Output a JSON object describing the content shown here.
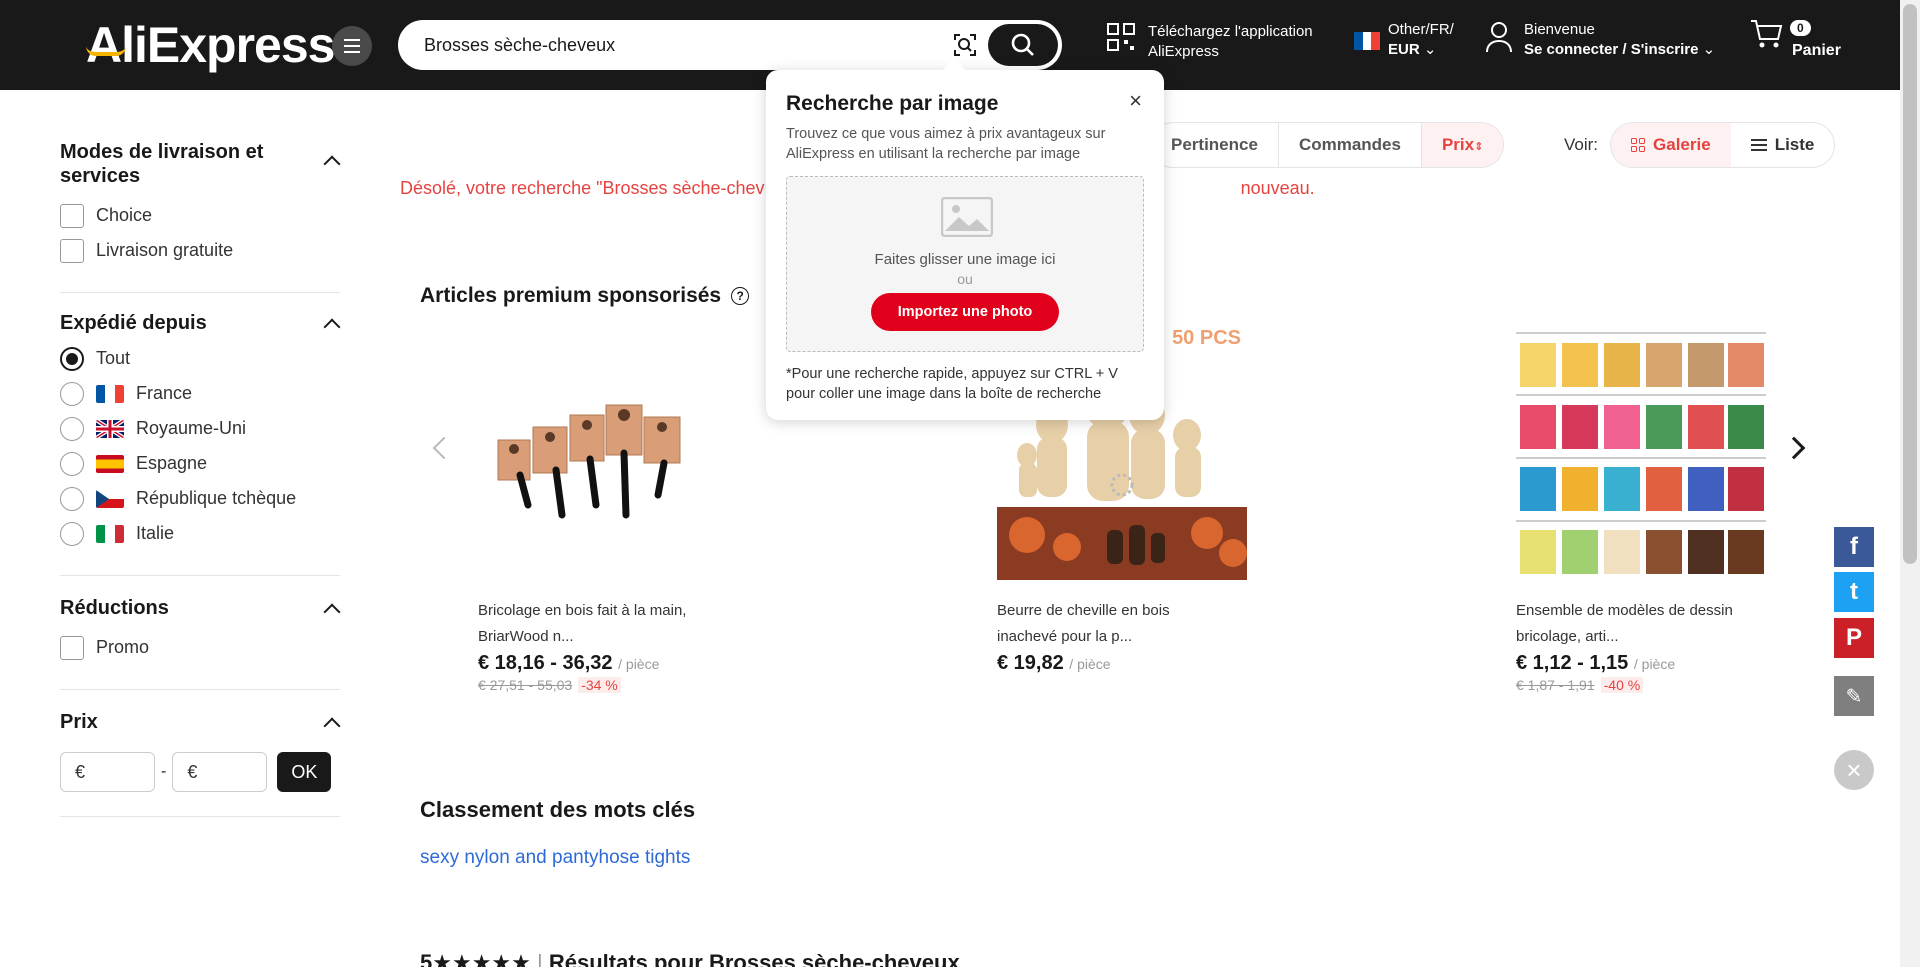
{
  "header": {
    "logo": "AliExpress",
    "search_value": "Brosses sèche-cheveux",
    "app_line1": "Téléchargez l'application",
    "app_line2": "AliExpress",
    "lang_line1": "Other/FR/",
    "lang_line2": "EUR",
    "user_line1": "Bienvenue",
    "user_line2": "Se connecter / S'inscrire",
    "cart_count": "0",
    "cart_label": "Panier"
  },
  "filters": {
    "delivery": {
      "title": "Modes de livraison et services",
      "items": [
        "Choice",
        "Livraison gratuite"
      ]
    },
    "ship_from": {
      "title": "Expédié depuis",
      "selected": "Tout",
      "items": [
        "Tout",
        "France",
        "Royaume-Uni",
        "Espagne",
        "République tchèque",
        "Italie"
      ]
    },
    "discounts": {
      "title": "Réductions",
      "items": [
        "Promo"
      ]
    },
    "price": {
      "title": "Prix",
      "min_placeholder": "€",
      "max_placeholder": "€",
      "separator": "-",
      "ok_label": "OK"
    }
  },
  "sort": {
    "options": [
      "Pertinence",
      "Commandes",
      "Prix"
    ],
    "active": "Prix",
    "view_label": "Voir:",
    "gallery_label": "Galerie",
    "list_label": "Liste"
  },
  "sorry_message": "Désolé, votre recherche \"Brosses sèche-chev",
  "sorry_message_end": "nouveau.",
  "sponsored": {
    "title": "Articles premium sponsorisés",
    "products": [
      {
        "title_line1": "Bricolage en bois fait à la main,",
        "title_line2": "BriarWood n...",
        "price": "€ 18,16 - 36,32",
        "unit": "/ pièce",
        "old_price": "€ 27,51 - 55,03",
        "discount": "-34 %"
      },
      {
        "title_line1": "Beurre de cheville en bois",
        "title_line2": "inachevé pour la p...",
        "price": "€ 19,82",
        "unit": "/ pièce",
        "old_price": "",
        "discount": "",
        "image_badge": "50 PCS"
      },
      {
        "title_line1": "Ensemble de modèles de dessin",
        "title_line2": "bricolage, arti...",
        "price": "€ 1,12 - 1,15",
        "unit": "/ pièce",
        "old_price": "€ 1,87 - 1,91",
        "discount": "-40 %"
      }
    ]
  },
  "keywords": {
    "title": "Classement des mots clés",
    "link": "sexy nylon and pantyhose tights"
  },
  "results_heading": {
    "prefix": "5",
    "text": "Résultats pour Brosses sèche-cheveux"
  },
  "popup": {
    "title": "Recherche par image",
    "close": "×",
    "description": "Trouvez ce que vous aimez à prix avantageux sur AliExpress en utilisant la recherche par image",
    "drop_text": "Faites glisser une image ici",
    "or_text": "ou",
    "upload_label": "Importez une photo",
    "note": "*Pour une recherche rapide, appuyez sur CTRL + V pour coller une image dans la boîte de recherche"
  },
  "social": {
    "facebook": "f",
    "twitter": "t",
    "pinterest": "P",
    "edit": "✎",
    "close": "×"
  },
  "colors": {
    "header_bg": "#191919",
    "accent_red": "#e64340",
    "upload_red": "#e0001b",
    "link_blue": "#2e6ad6",
    "facebook": "#3b5998",
    "twitter": "#1da1f2",
    "pinterest": "#cb2027",
    "edit": "#7f7f7f"
  }
}
